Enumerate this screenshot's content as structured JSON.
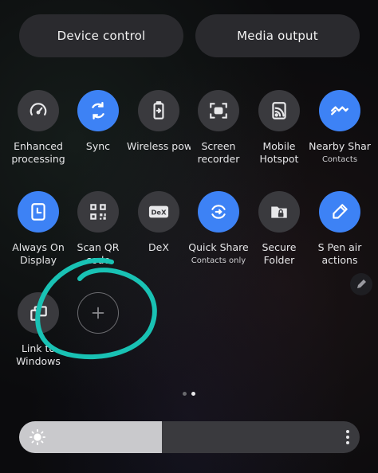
{
  "top_buttons": {
    "device_control": "Device control",
    "media_output": "Media output"
  },
  "tiles": [
    {
      "label": "Enhanced processing",
      "sub": "",
      "icon": "speedometer-icon",
      "on": false
    },
    {
      "label": "Sync",
      "sub": "",
      "icon": "sync-icon",
      "on": true
    },
    {
      "label": "Wireless pow",
      "sub": "",
      "icon": "battery-share-icon",
      "on": false
    },
    {
      "label": "Screen recorder",
      "sub": "",
      "icon": "screen-recorder-icon",
      "on": false
    },
    {
      "label": "Mobile Hotspot",
      "sub": "",
      "icon": "hotspot-icon",
      "on": false
    },
    {
      "label": "Nearby Shar",
      "sub": "Contacts",
      "icon": "nearby-share-icon",
      "on": true
    },
    {
      "label": "Always On Display",
      "sub": "",
      "icon": "clock-icon",
      "on": true
    },
    {
      "label": "Scan QR code",
      "sub": "",
      "icon": "qr-code-icon",
      "on": false
    },
    {
      "label": "DeX",
      "sub": "",
      "icon": "dex-icon",
      "on": false
    },
    {
      "label": "Quick Share",
      "sub": "Contacts only",
      "icon": "quick-share-icon",
      "on": true
    },
    {
      "label": "Secure Folder",
      "sub": "",
      "icon": "secure-folder-icon",
      "on": false
    },
    {
      "label": "S Pen air actions",
      "sub": "",
      "icon": "s-pen-icon",
      "on": true
    },
    {
      "label": "Link to Windows",
      "sub": "",
      "icon": "link-to-windows-icon",
      "on": false
    }
  ],
  "brightness_level": 0.42,
  "page_indicator": {
    "count": 2,
    "active": 1
  },
  "colors": {
    "accent": "#3d82f5",
    "annotation": "#19c2b4"
  }
}
